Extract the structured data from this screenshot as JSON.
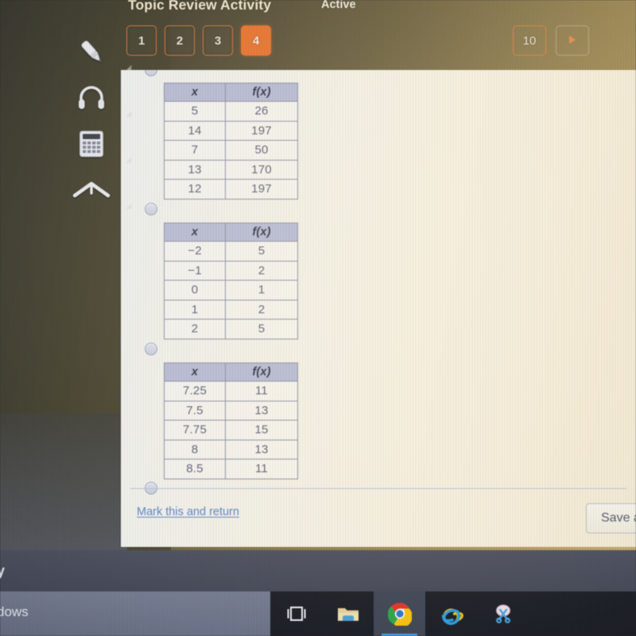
{
  "header": {
    "title": "Topic Review Activity",
    "status": "Active",
    "tabs": [
      {
        "label": "1",
        "active": false
      },
      {
        "label": "2",
        "active": false
      },
      {
        "label": "3",
        "active": false
      },
      {
        "label": "4",
        "active": true
      }
    ],
    "last_page": "10",
    "next_icon": "play-triangle-icon",
    "accent_color": "#e8722e"
  },
  "toolbar": {
    "items": [
      {
        "name": "highlighter-icon",
        "label": "Highlighter"
      },
      {
        "name": "headphones-icon",
        "label": "Read aloud"
      },
      {
        "name": "calculator-icon",
        "label": "Calculator"
      },
      {
        "name": "collapse-up-icon",
        "label": "Collapse"
      }
    ]
  },
  "question": {
    "choices": [
      {
        "headers": [
          "x",
          "f(x)"
        ],
        "rows": [
          [
            "5",
            "26"
          ],
          [
            "14",
            "197"
          ],
          [
            "7",
            "50"
          ],
          [
            "13",
            "170"
          ],
          [
            "12",
            "197"
          ]
        ]
      },
      {
        "headers": [
          "x",
          "f(x)"
        ],
        "rows": [
          [
            "−2",
            "5"
          ],
          [
            "−1",
            "2"
          ],
          [
            "0",
            "1"
          ],
          [
            "1",
            "2"
          ],
          [
            "2",
            "5"
          ]
        ]
      },
      {
        "headers": [
          "x",
          "f(x)"
        ],
        "rows": [
          [
            "7.25",
            "11"
          ],
          [
            "7.5",
            "13"
          ],
          [
            "7.75",
            "15"
          ],
          [
            "8",
            "13"
          ],
          [
            "8.5",
            "11"
          ]
        ]
      }
    ]
  },
  "footer": {
    "mark_link": "Mark this and return",
    "save_button": "Save a",
    "link_color": "#5b84c4"
  },
  "windows": {
    "strip_text": "y",
    "taskbar_text": "dows",
    "taskbar_icons": [
      {
        "name": "task-view-icon",
        "active": false
      },
      {
        "name": "file-explorer-icon",
        "active": false
      },
      {
        "name": "chrome-icon",
        "active": true
      },
      {
        "name": "internet-explorer-icon",
        "active": false
      },
      {
        "name": "snipping-tool-icon",
        "active": false
      }
    ]
  }
}
